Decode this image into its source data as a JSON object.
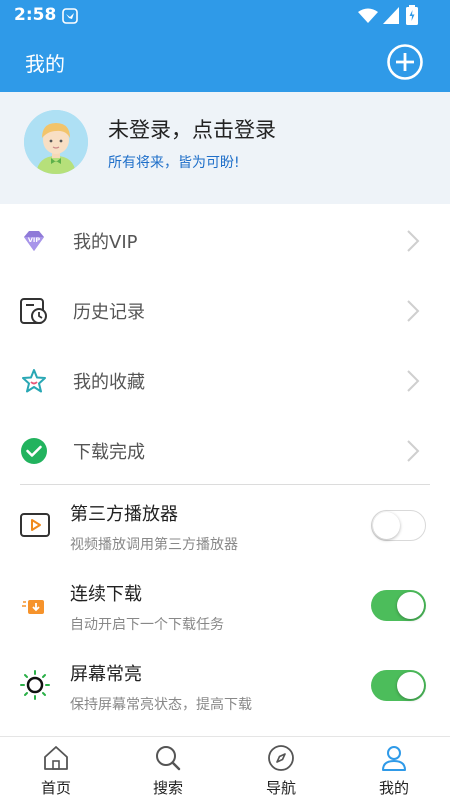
{
  "status_bar": {
    "time": "2:58"
  },
  "app_bar": {
    "title": "我的"
  },
  "profile": {
    "login_text": "未登录，点击登录",
    "motto": "所有将来，皆为可盼!"
  },
  "menu": [
    {
      "label": "我的VIP",
      "icon": "vip-diamond-icon"
    },
    {
      "label": "历史记录",
      "icon": "history-clock-icon"
    },
    {
      "label": "我的收藏",
      "icon": "star-icon"
    },
    {
      "label": "下载完成",
      "icon": "check-circle-icon"
    }
  ],
  "settings": [
    {
      "title": "第三方播放器",
      "desc": "视频播放调用第三方播放器",
      "enabled": false,
      "icon": "player-icon"
    },
    {
      "title": "连续下载",
      "desc": "自动开启下一个下载任务",
      "enabled": true,
      "icon": "download-box-icon"
    },
    {
      "title": "屏幕常亮",
      "desc": "保持屏幕常亮状态，提高下载",
      "enabled": true,
      "icon": "sun-icon"
    }
  ],
  "nav": [
    {
      "label": "首页",
      "icon": "home-icon"
    },
    {
      "label": "搜索",
      "icon": "search-icon"
    },
    {
      "label": "导航",
      "icon": "compass-icon"
    },
    {
      "label": "我的",
      "icon": "user-icon",
      "active": true
    }
  ],
  "colors": {
    "primary": "#2f9ae8",
    "toggle_on": "#4cbd5b",
    "motto": "#1f6fc9",
    "profile_bg": "#eef3f8"
  }
}
